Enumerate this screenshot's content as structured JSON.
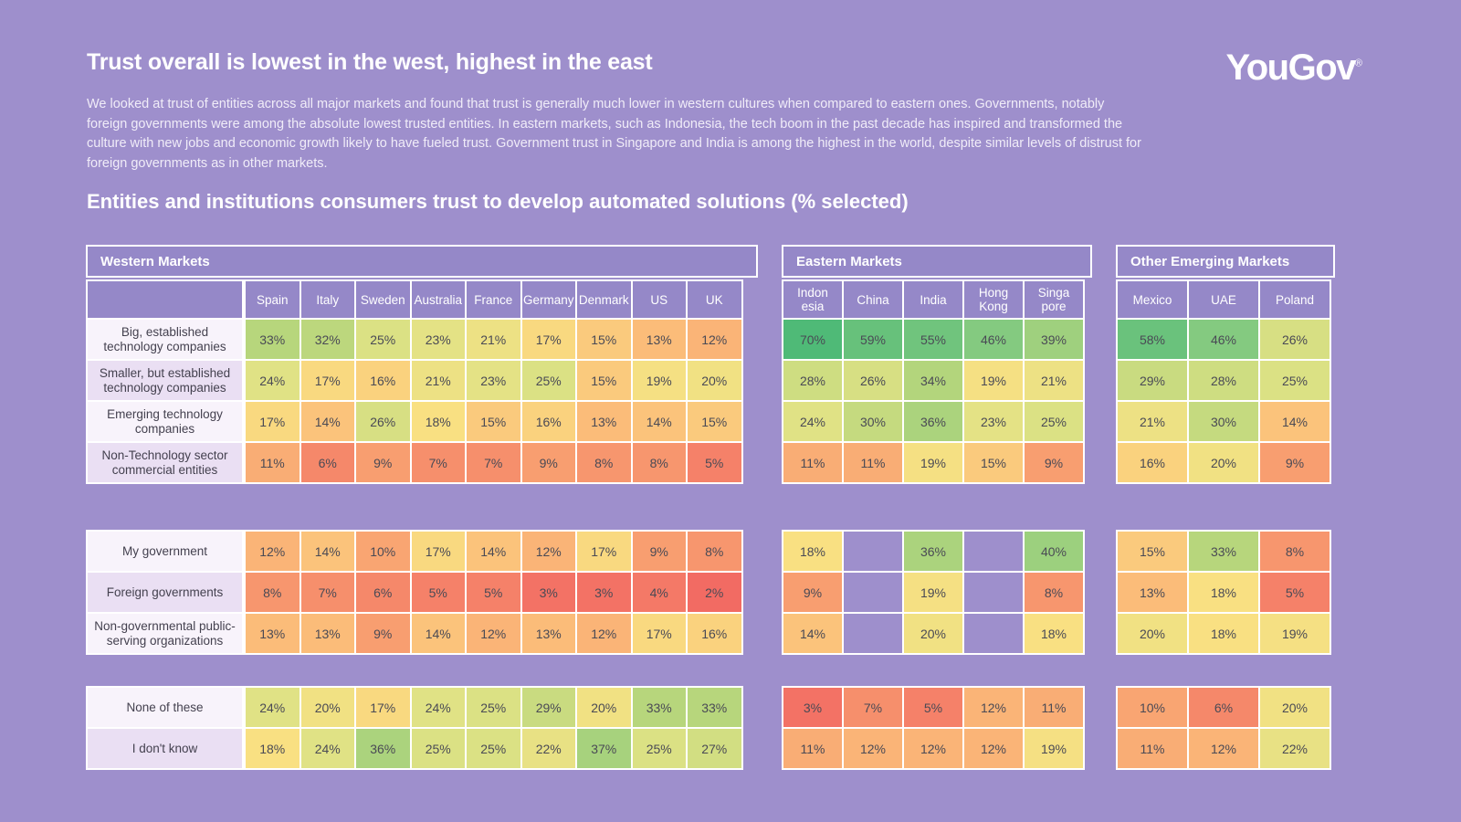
{
  "header": {
    "headline": "Trust overall is lowest in the west, highest in the east",
    "intro": "We looked at trust of entities across all major markets and found that trust is generally much lower in western cultures when compared to eastern ones. Governments, notably foreign governments were among the absolute lowest trusted entities. In eastern markets, such as Indonesia, the tech boom in the past decade has inspired and transformed the culture with new jobs and economic growth likely to have fueled trust. Government trust in Singapore and India is among the highest in the world, despite similar levels of distrust for foreign governments as in other markets.",
    "subhead": "Entities and institutions consumers trust to develop automated solutions (% selected)",
    "logo": "YouGov",
    "logo_mark": "®"
  },
  "colors": {
    "background": "#9e8fcc",
    "header_purple": "#9588c8",
    "label_light": "#f8f3fb",
    "label_dark": "#eadff3",
    "scale_high": "#4fba77",
    "scale_mid": "#f6e67e",
    "scale_low": "#f26b63",
    "text": "#4a4a55"
  },
  "row_labels_block_1": [
    "Big, established technology companies",
    "Smaller, but established technology companies",
    "Emerging technology companies",
    "Non-Technology sector commercial entities"
  ],
  "row_labels_block_2": [
    "My government",
    "Foreign governments",
    "Non-governmental public-serving organizations"
  ],
  "row_labels_block_3": [
    "None of these",
    "I don't know"
  ],
  "chart_data": {
    "type": "heatmap",
    "title": "Entities and institutions consumers trust to develop automated solutions (% selected)",
    "unit": "%",
    "value_range": [
      2,
      70
    ],
    "groups": [
      {
        "name": "Western Markets",
        "categories": [
          "Spain",
          "Italy",
          "Sweden",
          "Australia",
          "France",
          "Germany",
          "Denmark",
          "US",
          "UK"
        ],
        "sections": [
          {
            "rows": [
              {
                "label": "Big, established technology companies",
                "values": [
                  33,
                  32,
                  25,
                  23,
                  21,
                  17,
                  15,
                  13,
                  12
                ]
              },
              {
                "label": "Smaller, but established technology companies",
                "values": [
                  24,
                  17,
                  16,
                  21,
                  23,
                  25,
                  15,
                  19,
                  20
                ]
              },
              {
                "label": "Emerging technology companies",
                "values": [
                  17,
                  14,
                  26,
                  18,
                  15,
                  16,
                  13,
                  14,
                  15
                ]
              },
              {
                "label": "Non-Technology sector commercial entities",
                "values": [
                  11,
                  6,
                  9,
                  7,
                  7,
                  9,
                  8,
                  8,
                  5
                ]
              }
            ]
          },
          {
            "rows": [
              {
                "label": "My government",
                "values": [
                  12,
                  14,
                  10,
                  17,
                  14,
                  12,
                  17,
                  9,
                  8
                ]
              },
              {
                "label": "Foreign governments",
                "values": [
                  8,
                  7,
                  6,
                  5,
                  5,
                  3,
                  3,
                  4,
                  2
                ]
              },
              {
                "label": "Non-governmental public-serving organizations",
                "values": [
                  13,
                  13,
                  9,
                  14,
                  12,
                  13,
                  12,
                  17,
                  16
                ]
              }
            ]
          },
          {
            "rows": [
              {
                "label": "None of these",
                "values": [
                  24,
                  20,
                  17,
                  24,
                  25,
                  29,
                  20,
                  33,
                  33
                ]
              },
              {
                "label": "I don't know",
                "values": [
                  18,
                  24,
                  36,
                  25,
                  25,
                  22,
                  37,
                  25,
                  27
                ]
              }
            ]
          }
        ]
      },
      {
        "name": "Eastern Markets",
        "categories": [
          "Indon esia",
          "China",
          "India",
          "Hong Kong",
          "Singa pore"
        ],
        "sections": [
          {
            "rows": [
              {
                "label": "Big, established technology companies",
                "values": [
                  70,
                  59,
                  55,
                  46,
                  39
                ]
              },
              {
                "label": "Smaller, but established technology companies",
                "values": [
                  28,
                  26,
                  34,
                  19,
                  21
                ]
              },
              {
                "label": "Emerging technology companies",
                "values": [
                  24,
                  30,
                  36,
                  23,
                  25
                ]
              },
              {
                "label": "Non-Technology sector commercial entities",
                "values": [
                  11,
                  11,
                  19,
                  15,
                  9
                ]
              }
            ]
          },
          {
            "rows": [
              {
                "label": "My government",
                "values": [
                  18,
                  null,
                  36,
                  null,
                  40
                ]
              },
              {
                "label": "Foreign governments",
                "values": [
                  9,
                  null,
                  19,
                  null,
                  8
                ]
              },
              {
                "label": "Non-governmental public-serving organizations",
                "values": [
                  14,
                  null,
                  20,
                  null,
                  18
                ]
              }
            ]
          },
          {
            "rows": [
              {
                "label": "None of these",
                "values": [
                  3,
                  7,
                  5,
                  12,
                  11
                ]
              },
              {
                "label": "I don't know",
                "values": [
                  11,
                  12,
                  12,
                  12,
                  19
                ]
              }
            ]
          }
        ]
      },
      {
        "name": "Other Emerging Markets",
        "categories": [
          "Mexico",
          "UAE",
          "Poland"
        ],
        "sections": [
          {
            "rows": [
              {
                "label": "Big, established technology companies",
                "values": [
                  58,
                  46,
                  26
                ]
              },
              {
                "label": "Smaller, but established technology companies",
                "values": [
                  29,
                  28,
                  25
                ]
              },
              {
                "label": "Emerging technology companies",
                "values": [
                  21,
                  30,
                  14
                ]
              },
              {
                "label": "Non-Technology sector commercial entities",
                "values": [
                  16,
                  20,
                  9
                ]
              }
            ]
          },
          {
            "rows": [
              {
                "label": "My government",
                "values": [
                  15,
                  33,
                  8
                ]
              },
              {
                "label": "Foreign governments",
                "values": [
                  13,
                  18,
                  5
                ]
              },
              {
                "label": "Non-governmental public-serving organizations",
                "values": [
                  20,
                  18,
                  19
                ]
              }
            ]
          },
          {
            "rows": [
              {
                "label": "None of these",
                "values": [
                  10,
                  6,
                  20
                ]
              },
              {
                "label": "I don't know",
                "values": [
                  11,
                  12,
                  22
                ]
              }
            ]
          }
        ]
      }
    ]
  }
}
